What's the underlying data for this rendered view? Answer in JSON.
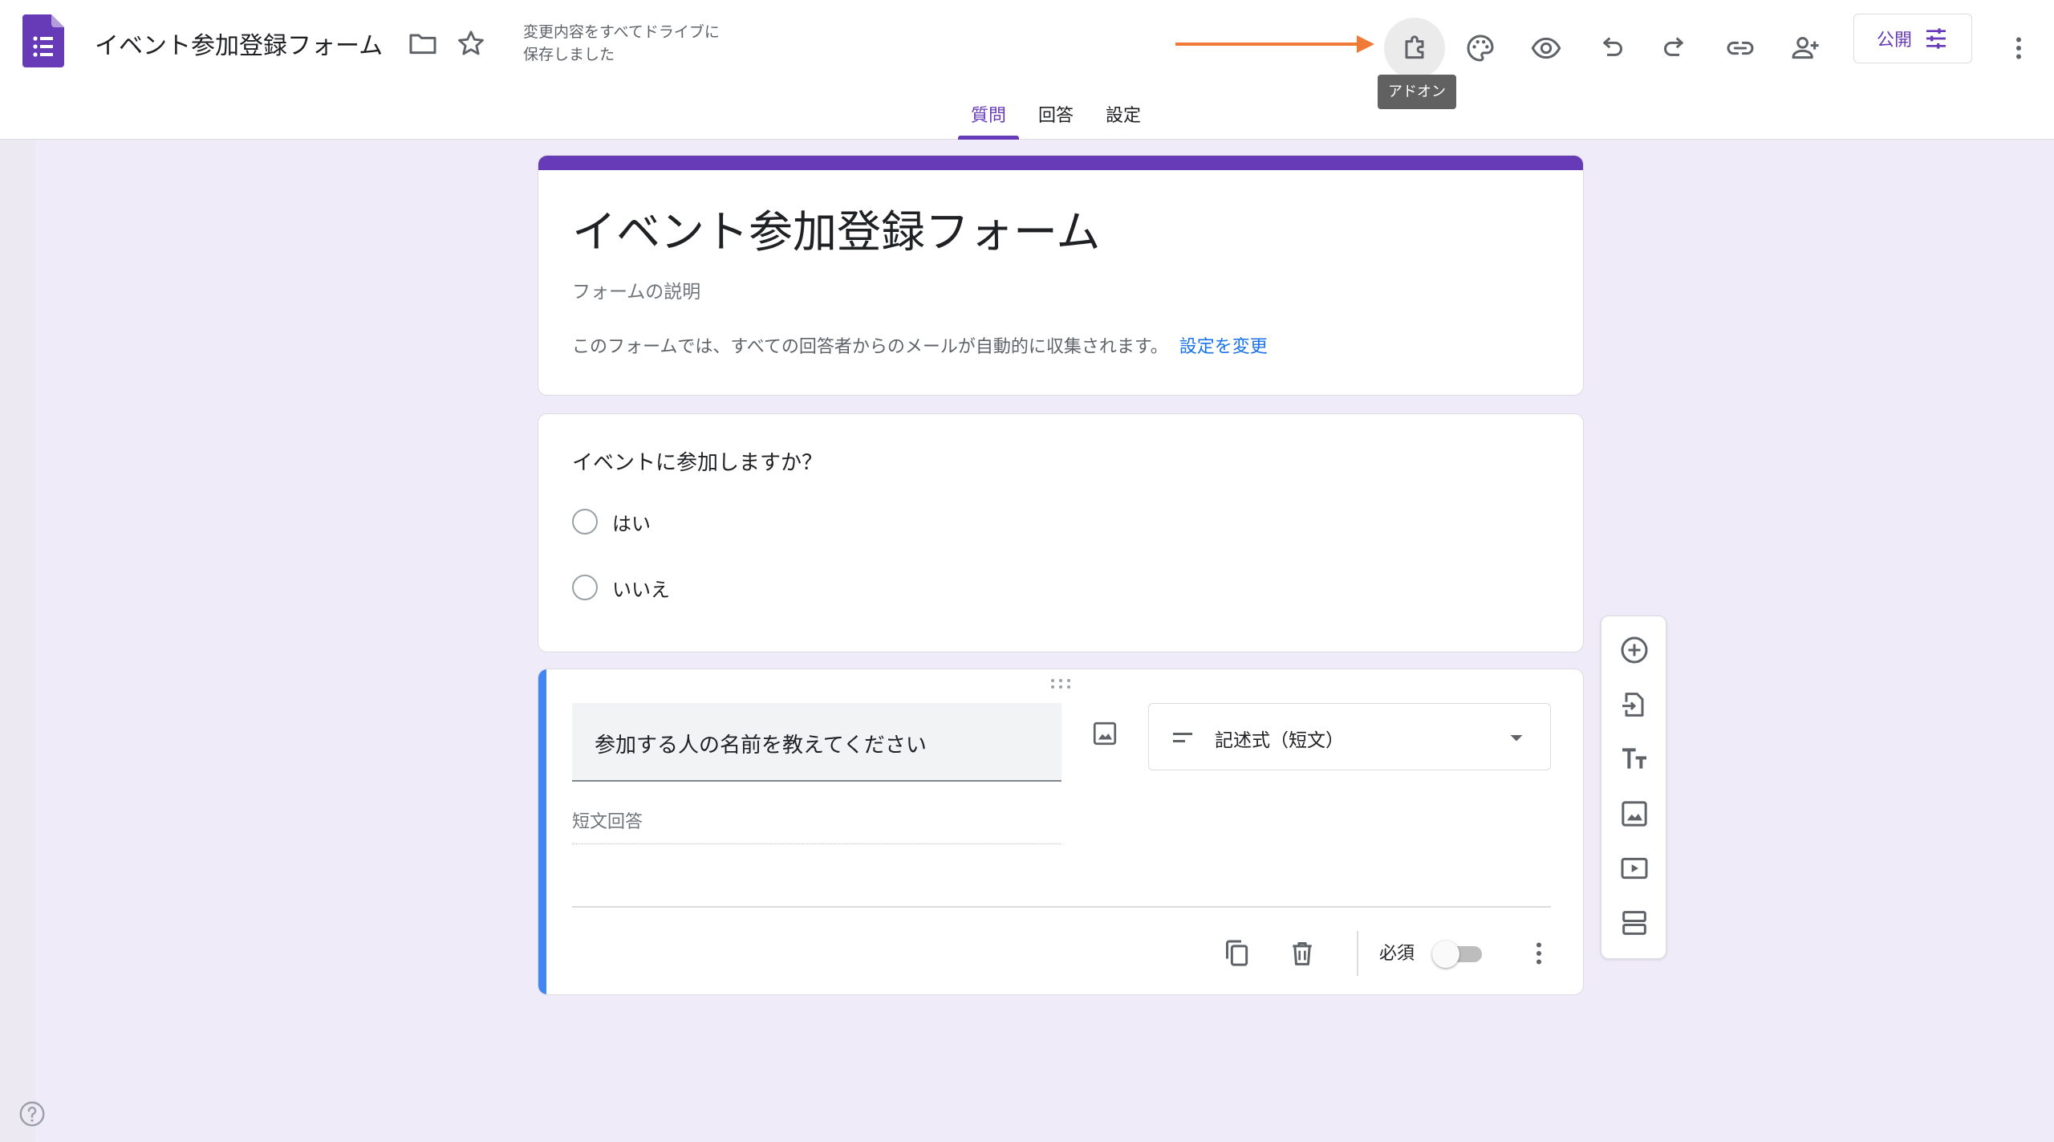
{
  "app": {
    "doc_title": "イベント参加登録フォーム",
    "save_status_line1": "変更内容をすべてドライブに",
    "save_status_line2": "保存しました",
    "accent_color": "#673ab7",
    "background_color": "#f0ebf8"
  },
  "toolbar": {
    "icons": [
      "addon-icon",
      "palette-icon",
      "preview-icon",
      "undo-icon",
      "redo-icon",
      "link-icon",
      "add-collaborator-icon",
      "more-vert-icon"
    ],
    "tooltip": "アドオン",
    "publish_label": "公開"
  },
  "tabs": [
    {
      "label": "質問",
      "active": true
    },
    {
      "label": "回答",
      "active": false
    },
    {
      "label": "設定",
      "active": false
    }
  ],
  "form": {
    "title": "イベント参加登録フォーム",
    "description_placeholder": "フォームの説明",
    "email_note": "このフォームでは、すべての回答者からのメールが自動的に収集されます。",
    "email_link": "設定を変更"
  },
  "questions": [
    {
      "text": "イベントに参加しますか？",
      "type": "radio",
      "options": [
        "はい",
        "いいえ"
      ]
    },
    {
      "text": "参加する人の名前を教えてください",
      "type_label": "記述式（短文）",
      "answer_placeholder": "短文回答",
      "required_label": "必須",
      "required": false
    }
  ],
  "side_toolbar": {
    "icons": [
      "add-question-icon",
      "import-questions-icon",
      "add-title-icon",
      "add-image-icon",
      "add-video-icon",
      "add-section-icon"
    ]
  }
}
